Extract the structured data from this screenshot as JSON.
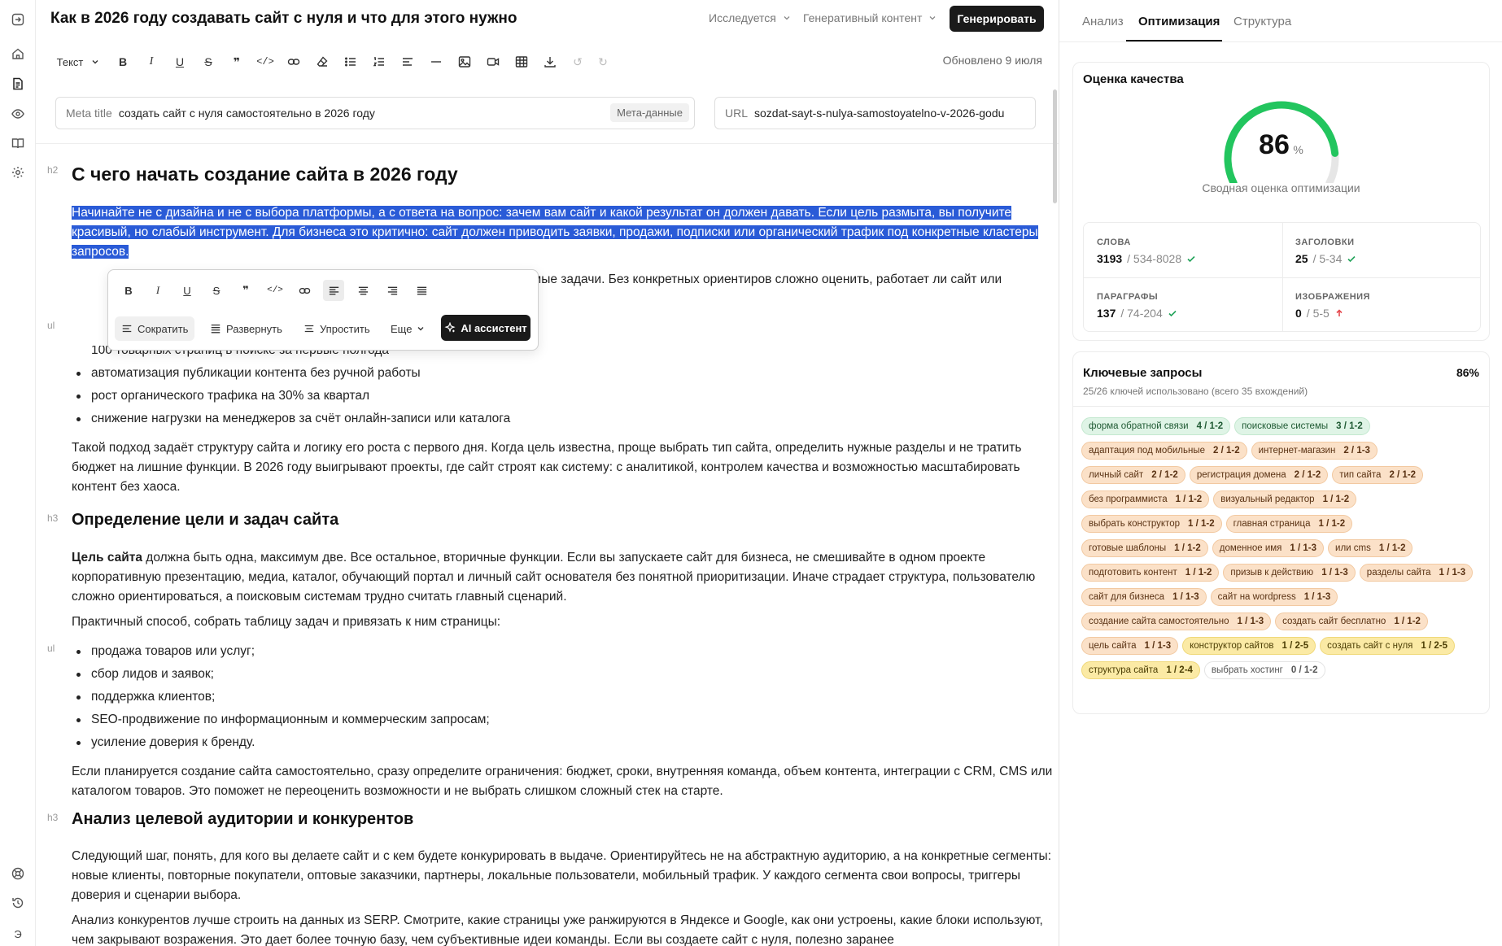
{
  "document": {
    "title": "Как в 2026 году создавать сайт с нуля и что для этого нужно",
    "status_dropdown": "Исследуется",
    "type_dropdown": "Генеративный контент",
    "generate_button": "Генерировать",
    "updated": "Обновлено 9 июля"
  },
  "toolbar": {
    "text_style": "Текст"
  },
  "meta": {
    "title_label": "Meta title",
    "title_value": "создать сайт с нуля самостоятельно в 2026 году",
    "meta_tag": "Мета-данные",
    "url_label": "URL",
    "url_value": "sozdat-sayt-s-nulya-samostoyatelno-v-2026-godu"
  },
  "content": {
    "h2_tag": "h2",
    "h2": "С чего начать создание сайта в 2026 году",
    "selected_paragraph": "Начинайте не с дизайна и не с выбора платформы, а с ответа на вопрос: зачем вам сайт и какой результат он должен давать. Если цель размыта, вы получите красивый, но слабый инструмент. Для бизнеса это критично: сайт должен приводить заявки, продажи, подписки или органический трафик под конкретные кластеры запросов.",
    "partial_line": "мерим­ые задачи. Без конкретных ориентиров сложно оценить, работает ли сайт или",
    "ul_tag": "ul",
    "list1": [
      "100 товарных страниц в поиске за первые полгода",
      "автоматизация публикации контента без ручной работы",
      "рост органического трафика на 30% за квартал",
      "снижение нагрузки на менеджеров за счёт онлайн-записи или каталога"
    ],
    "p2": "Такой подход задаёт структуру сайта и логику его роста с первого дня. Когда цель известна, проще выбрать тип сайта, определить нужные разделы и не тратить бюджет на лишние функции. В 2026 году выигрывают проекты, где сайт строят как систему: с аналитикой, контролем качества и возможностью масштабировать контент без хаоса.",
    "h3_tag": "h3",
    "h3_1": "Определение цели и задач сайта",
    "p3_bold": "Цель сайта",
    "p3": " должна быть одна, максимум две. Все остальное, вторичные функции. Если вы запускаете сайт для бизнеса, не смешивайте в одном проекте корпоративную презентацию, медиа, каталог, обучающий портал и личный сайт основателя без понятной приоритизации. Иначе страдает структура, пользователю сложно ориентироваться, а поисковым системам трудно считать главный сценарий.",
    "p4": "Практичный способ, собрать таблицу задач и привязать к ним страницы:",
    "list2": [
      "продажа товаров или услуг;",
      "сбор лидов и заявок;",
      "поддержка клиентов;",
      "SEO-продвижение по информационным и коммерческим запросам;",
      "усиление доверия к бренду."
    ],
    "p5": "Если планируется создание сайта самостоятельно, сразу определите ограничения: бюджет, сроки, внутренняя команда, объем контента, интеграции с CRM, CMS или каталогом товаров. Это поможет не переоценить возможности и не выбрать слишком сложный стек на старте.",
    "h3_2": "Анализ целевой аудитории и конкурентов",
    "p6": "Следующий шаг, понять, для кого вы делаете сайт и с кем будете конкурировать в выдаче. Ориентируйтесь не на абстрактную аудиторию, а на конкретные сегменты: новые клиенты, повторные покупатели, оптовые заказчики, партнеры, локальные пользователи, мобильный трафик. У каждого сегмента свои вопросы, триггеры доверия и сценарии выбора.",
    "p7": "Анализ конкурентов лучше строить на данных из SERP. Смотрите, какие страницы уже ранжируются в Яндексе и Google, как они устроены, какие блоки используют, чем закрывают возражения. Это дает более точную базу, чем субъективные идеи команды. Если вы создаете сайт с нуля, полезно заранее"
  },
  "popup": {
    "actions": [
      "Сократить",
      "Развернуть",
      "Упростить",
      "Еще"
    ],
    "ai_button": "AI ассистент"
  },
  "panel": {
    "tabs": [
      "Анализ",
      "Оптимизация",
      "Структура"
    ],
    "quality_title": "Оценка качества",
    "score": "86",
    "score_unit": "%",
    "score_fraction": 0.86,
    "score_caption": "Сводная оценка оптимизации",
    "stats": [
      {
        "label": "СЛОВА",
        "value": "3193",
        "range": "/ 534-8028",
        "state": "ok"
      },
      {
        "label": "ЗАГОЛОВКИ",
        "value": "25",
        "range": "/ 5-34",
        "state": "ok"
      },
      {
        "label": "ПАРАГРАФЫ",
        "value": "137",
        "range": "/ 74-204",
        "state": "ok"
      },
      {
        "label": "ИЗОБРАЖЕНИЯ",
        "value": "0",
        "range": "/ 5-5",
        "state": "up"
      }
    ],
    "keywords_title": "Ключевые запросы",
    "keywords_percent": "86%",
    "keywords_sub": "25/26 ключей использовано (всего 35 вхождений)",
    "keywords": [
      {
        "text": "форма обратной связи",
        "count": "4 / 1-2",
        "color": "green"
      },
      {
        "text": "поисковые системы",
        "count": "3 / 1-2",
        "color": "green"
      },
      {
        "text": "адаптация под мобильные",
        "count": "2 / 1-2",
        "color": "orange"
      },
      {
        "text": "интернет-магазин",
        "count": "2 / 1-3",
        "color": "orange"
      },
      {
        "text": "личный сайт",
        "count": "2 / 1-2",
        "color": "orange"
      },
      {
        "text": "регистрация домена",
        "count": "2 / 1-2",
        "color": "orange"
      },
      {
        "text": "тип сайта",
        "count": "2 / 1-2",
        "color": "orange"
      },
      {
        "text": "без программиста",
        "count": "1 / 1-2",
        "color": "orange"
      },
      {
        "text": "визуальный редактор",
        "count": "1 / 1-2",
        "color": "orange"
      },
      {
        "text": "выбрать конструктор",
        "count": "1 / 1-2",
        "color": "orange"
      },
      {
        "text": "главная страница",
        "count": "1 / 1-2",
        "color": "orange"
      },
      {
        "text": "готовые шаблоны",
        "count": "1 / 1-2",
        "color": "orange"
      },
      {
        "text": "доменное имя",
        "count": "1 / 1-3",
        "color": "orange"
      },
      {
        "text": "или cms",
        "count": "1 / 1-2",
        "color": "orange"
      },
      {
        "text": "подготовить контент",
        "count": "1 / 1-2",
        "color": "orange"
      },
      {
        "text": "призыв к действию",
        "count": "1 / 1-3",
        "color": "orange"
      },
      {
        "text": "разделы сайта",
        "count": "1 / 1-3",
        "color": "orange"
      },
      {
        "text": "сайт для бизнеса",
        "count": "1 / 1-3",
        "color": "orange"
      },
      {
        "text": "сайт на wordpress",
        "count": "1 / 1-3",
        "color": "orange"
      },
      {
        "text": "создание сайта самостоятельно",
        "count": "1 / 1-3",
        "color": "orange"
      },
      {
        "text": "создать сайт бесплатно",
        "count": "1 / 1-2",
        "color": "orange"
      },
      {
        "text": "цель сайта",
        "count": "1 / 1-3",
        "color": "orange"
      },
      {
        "text": "конструктор сайтов",
        "count": "1 / 2-5",
        "color": "yellow"
      },
      {
        "text": "создать сайт с нуля",
        "count": "1 / 2-5",
        "color": "yellow"
      },
      {
        "text": "структура сайта",
        "count": "1 / 2-4",
        "color": "yellow"
      },
      {
        "text": "выбрать хостинг",
        "count": "0 / 1-2",
        "color": "plain"
      }
    ]
  },
  "colors": {
    "selection": "#2a5bd7",
    "gauge": "#22c55e",
    "gauge_track": "#e6e6e6",
    "ok": "#22a35a",
    "warn": "#e5484d"
  }
}
